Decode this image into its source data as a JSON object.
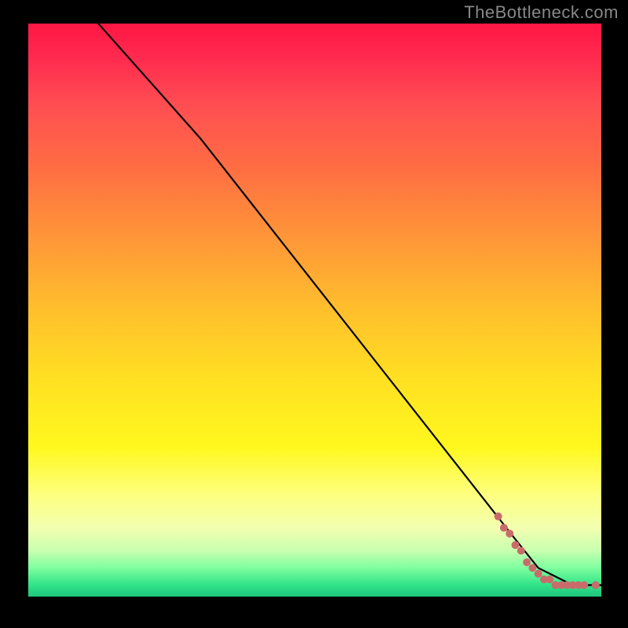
{
  "attribution": "TheBottleneck.com",
  "chart_data": {
    "type": "line",
    "xlabel": "",
    "ylabel": "",
    "xlim": [
      0,
      100
    ],
    "ylim": [
      0,
      100
    ],
    "grid": false,
    "legend": false,
    "line_series": {
      "name": "curve",
      "points": [
        {
          "x": 6,
          "y": 107
        },
        {
          "x": 30,
          "y": 80
        },
        {
          "x": 85,
          "y": 10
        },
        {
          "x": 89,
          "y": 5
        },
        {
          "x": 95,
          "y": 2
        },
        {
          "x": 100,
          "y": 2
        }
      ]
    },
    "scatter_series": {
      "name": "points-near-baseline",
      "color": "#c96b6b",
      "points": [
        {
          "x": 82,
          "y": 14
        },
        {
          "x": 83,
          "y": 12
        },
        {
          "x": 84,
          "y": 11
        },
        {
          "x": 85,
          "y": 9
        },
        {
          "x": 86,
          "y": 8
        },
        {
          "x": 87,
          "y": 6
        },
        {
          "x": 88,
          "y": 5
        },
        {
          "x": 89,
          "y": 4
        },
        {
          "x": 90,
          "y": 3
        },
        {
          "x": 91,
          "y": 3
        },
        {
          "x": 92,
          "y": 2
        },
        {
          "x": 93,
          "y": 2
        },
        {
          "x": 94,
          "y": 2
        },
        {
          "x": 95,
          "y": 2
        },
        {
          "x": 96,
          "y": 2
        },
        {
          "x": 97,
          "y": 2
        },
        {
          "x": 99,
          "y": 2
        },
        {
          "x": 101,
          "y": 2
        }
      ]
    },
    "gradient_stops": [
      {
        "pos": 0,
        "color": "#ff1744"
      },
      {
        "pos": 14,
        "color": "#ff4d52"
      },
      {
        "pos": 26,
        "color": "#ff7042"
      },
      {
        "pos": 38,
        "color": "#ff9838"
      },
      {
        "pos": 50,
        "color": "#ffbf2c"
      },
      {
        "pos": 62,
        "color": "#ffe022"
      },
      {
        "pos": 74,
        "color": "#fff81e"
      },
      {
        "pos": 82,
        "color": "#fdff7d"
      },
      {
        "pos": 88,
        "color": "#f3ffb0"
      },
      {
        "pos": 92,
        "color": "#c8ffb0"
      },
      {
        "pos": 95,
        "color": "#7dff9e"
      },
      {
        "pos": 98,
        "color": "#30e389"
      },
      {
        "pos": 100,
        "color": "#1fc57c"
      }
    ]
  }
}
